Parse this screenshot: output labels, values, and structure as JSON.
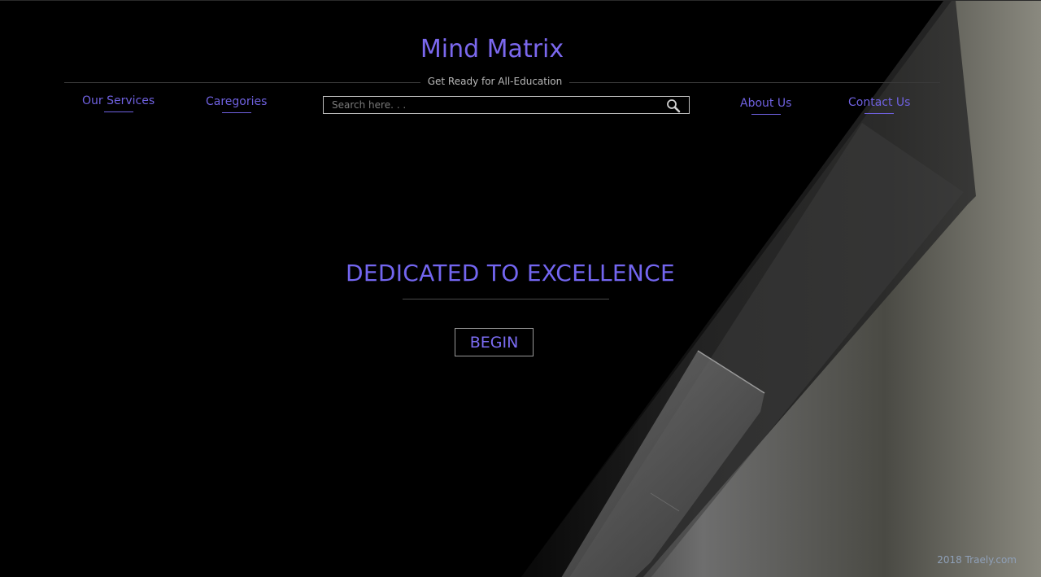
{
  "header": {
    "title": "Mind Matrix",
    "tagline": "Get Ready for All-Education"
  },
  "nav": {
    "services": "Our Services",
    "categories": "Caregories",
    "about": "About Us",
    "contact": "Contact Us"
  },
  "search": {
    "placeholder": "Search here. . .",
    "value": "",
    "icon": "search-icon"
  },
  "hero": {
    "heading": "DEDICATED TO EXCELLENCE",
    "button_label": "BEGIN"
  },
  "footer": {
    "text": "2018 Traely.com"
  },
  "colors": {
    "accent": "#7366f0",
    "background": "#000000"
  }
}
